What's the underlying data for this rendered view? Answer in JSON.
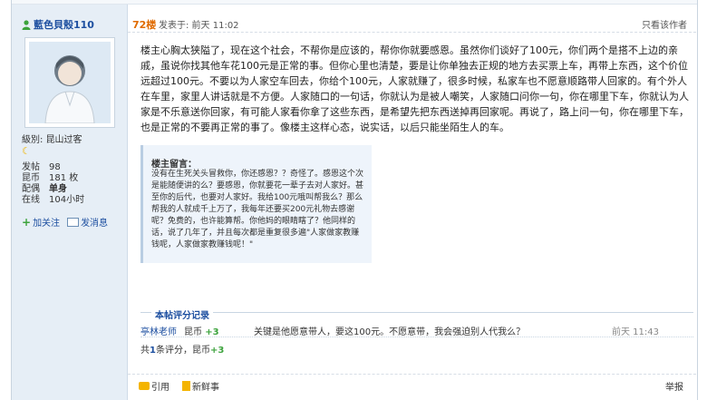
{
  "user": {
    "name": "藍色貝殼110",
    "level_label": "級別",
    "level_value": "昆山过客",
    "stats": [
      {
        "key": "发帖",
        "value": "98"
      },
      {
        "key": "昆币",
        "value": "181 枚"
      },
      {
        "key": "配偶",
        "value": "单身"
      },
      {
        "key": "在线",
        "value": "104小时"
      }
    ],
    "follow": "加关注",
    "message": "发消息"
  },
  "post": {
    "floor": "72楼",
    "posted": "发表于: 前天 11:02",
    "only_author": "只看该作者",
    "content": "楼主心胸太狭隘了，现在这个社会，不帮你是应该的，帮你你就要感恩。虽然你们谈好了100元，你们两个是搭不上边的亲戚，虽说你找其他车花100元是正常的事。但你心里也清楚，要是让你单独去正规的地方去买票上车，再带上东西，这个价位远超过100元。不要以为人家空车回去，你给个100元，人家就赚了，很多时候，私家车也不愿意顺路带人回家的。有个外人在车里，家里人讲话就是不方便。人家随口的一句话，你就认为是被人嘲笑，人家随口问你一句，你在哪里下车，你就认为人家是不乐意送你回家，有可能人家看你拿了这些东西，是希望先把东西送掉再回家呢。再说了，路上问一句，你在哪里下车，也是正常的不要再正常的事了。像楼主这样心态，说实话，以后只能坐陌生人的车。",
    "quote_title": "楼主留言：",
    "quote_text": "没有在生死关头冒救你，你还感恩？？奇怪了。感恩这个次是能随便讲的么？要感恩，你就要花一辈子去对人家好。甚至你的后代，也要对人家好。我给100元哦叫帮我么？那么帮我的人就成千上万了，我每年还要买200元礼物去感谢呢？免费的，也许能算帮。你他妈的眼睛瞎了？他同样的话，说了几年了，并且每次都是重复很多遍\"人家做家教赚钱呢，人家做家教赚钱呢！\""
  },
  "rating": {
    "title": "本帖评分记录",
    "user": "亭林老师",
    "coin_label": "昆币",
    "coin_value": "+3",
    "reason": "关键是他愿意带人，要这100元。不愿意带，我会强迫别人代我么？",
    "time": "前天 11:43",
    "total_prefix": "共",
    "total_count": "1",
    "total_mid": "条评分，昆币",
    "total_value": "+3"
  },
  "footer": {
    "quote": "引用",
    "new_post": "新鲜事",
    "report": "举报"
  },
  "colors": {
    "sidebar_bg": "#e6eef6",
    "accent": "#1d4fa0",
    "floor": "#e06b00",
    "positive": "#3ca33c"
  }
}
